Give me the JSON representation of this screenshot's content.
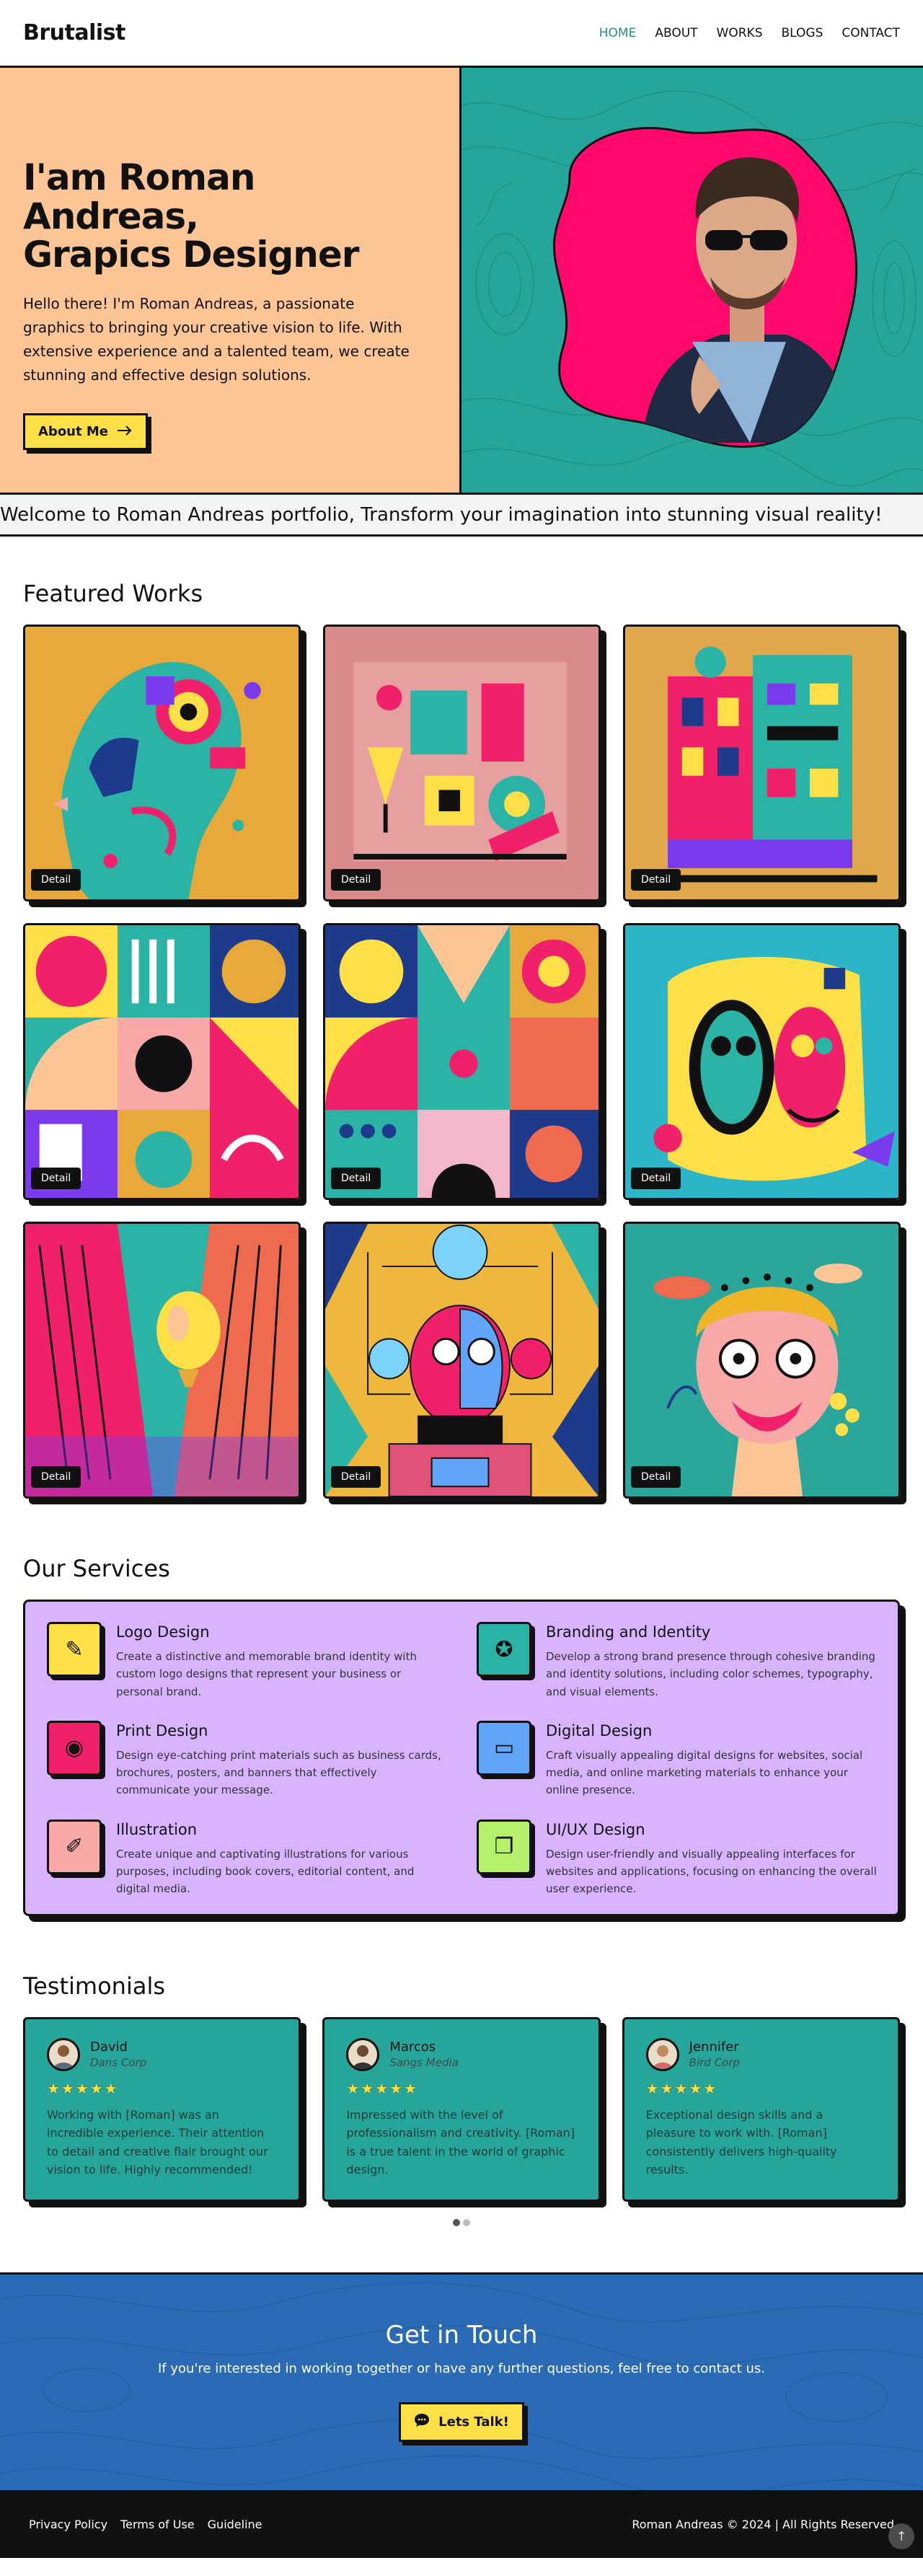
{
  "nav": {
    "logo": "Brutalist",
    "links": [
      "HOME",
      "ABOUT",
      "WORKS",
      "BLOGS",
      "CONTACT"
    ],
    "active": "HOME"
  },
  "hero": {
    "title": "I'am Roman Andreas,\nGrapics Designer",
    "text": "Hello there! I'm Roman Andreas, a passionate graphics to bringing your creative vision to life. With extensive experience and a talented team, we create stunning and effective design solutions.",
    "button_label": "About Me",
    "button_icon": "arrow-right-icon"
  },
  "marquee": "Welcome to Roman Andreas portfolio, Transform your imagination into stunning visual reality!",
  "works": {
    "title": "Featured Works",
    "detail_label": "Detail",
    "items": [
      {
        "name": "abstract-head-profile",
        "bg": "#e8a93a"
      },
      {
        "name": "geometric-still-life",
        "bg": "#d98a8a"
      },
      {
        "name": "colorful-building",
        "bg": "#e0a84a"
      },
      {
        "name": "pink-geometric-pattern",
        "bg": "#e56a8c"
      },
      {
        "name": "bauhaus-shapes",
        "bg": "#f2b7c9"
      },
      {
        "name": "abstract-face-cyan",
        "bg": "#2bb5c7"
      },
      {
        "name": "city-towers-balloon",
        "bg": "#3aa39a"
      },
      {
        "name": "robot-character",
        "bg": "#efb73c"
      },
      {
        "name": "man-with-glasses-illustration",
        "bg": "#2aa79a"
      }
    ]
  },
  "services": {
    "title": "Our Services",
    "items": [
      {
        "name": "Logo Design",
        "desc": "Create a distinctive and memorable brand identity with custom logo designs that represent your business or personal brand.",
        "icon": "pen-tool-icon",
        "color": "#fde047",
        "glyph": "✎"
      },
      {
        "name": "Branding and Identity",
        "desc": "Develop a strong brand presence through cohesive branding and identity solutions, including color schemes, typography, and visual elements.",
        "icon": "badge-icon",
        "color": "#2bb3a6",
        "glyph": "✪"
      },
      {
        "name": "Print Design",
        "desc": "Design eye-catching print materials such as business cards, brochures, posters, and banners that effectively communicate your message.",
        "icon": "palette-icon",
        "color": "#f0216a",
        "glyph": "◉"
      },
      {
        "name": "Digital Design",
        "desc": "Craft visually appealing digital designs for websites, social media, and online marketing materials to enhance your online presence.",
        "icon": "monitor-icon",
        "color": "#60a5fa",
        "glyph": "▭"
      },
      {
        "name": "Illustration",
        "desc": "Create unique and captivating illustrations for various purposes, including book covers, editorial content, and digital media.",
        "icon": "brush-icon",
        "color": "#f9a8a8",
        "glyph": "✐"
      },
      {
        "name": "UI/UX Design",
        "desc": "Design user-friendly and visually appealing interfaces for websites and applications, focusing on enhancing the overall user experience.",
        "icon": "layers-icon",
        "color": "#b5f06a",
        "glyph": "❐"
      }
    ]
  },
  "testimonials": {
    "title": "Testimonials",
    "stars": "★★★★★",
    "items": [
      {
        "name": "David",
        "company": "Dans Corp",
        "quote": "Working with [Roman] was an incredible experience. Their attention to detail and creative flair brought our vision to life. Highly recommended!"
      },
      {
        "name": "Marcos",
        "company": "Sangs Media",
        "quote": "Impressed with the level of professionalism and creativity. [Roman] is a true talent in the world of graphic design."
      },
      {
        "name": "Jennifer",
        "company": "Bird Corp",
        "quote": "Exceptional design skills and a pleasure to work with. [Roman] consistently delivers high-quality results."
      }
    ]
  },
  "contact": {
    "title": "Get in Touch",
    "text": "If you're interested in working together or have any further questions, feel free to contact us.",
    "button_label": "Lets Talk!",
    "button_icon": "chat-bubble-icon"
  },
  "footer": {
    "links": [
      "Privacy Policy",
      "Terms of Use",
      "Guideline"
    ],
    "copyright": "Roman Andreas © 2024 | All Rights Reserved",
    "to_top_icon": "arrow-up-icon"
  }
}
